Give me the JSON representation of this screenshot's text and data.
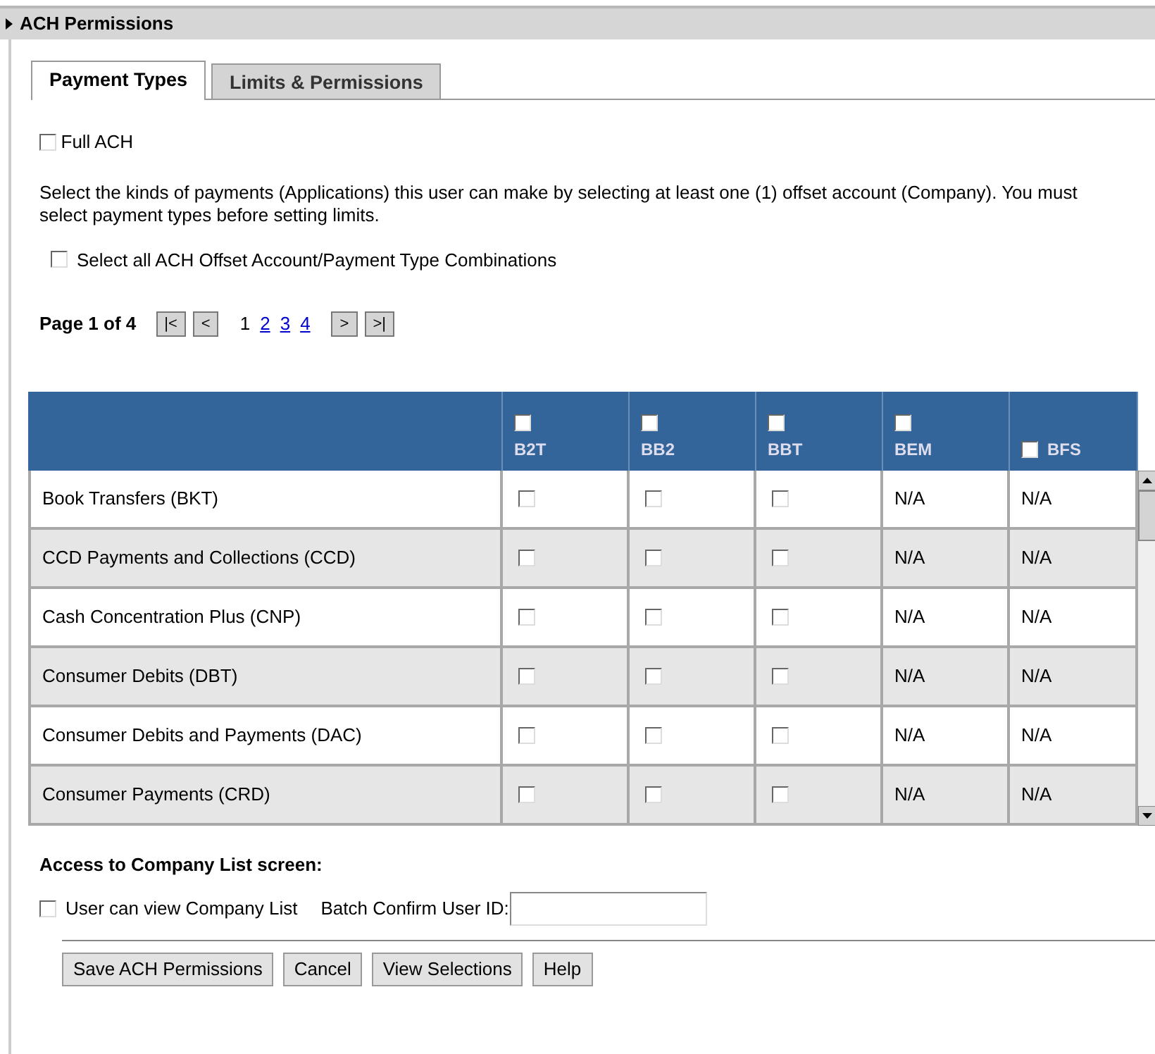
{
  "section": {
    "title": "ACH Permissions"
  },
  "tabs": [
    {
      "label": "Payment Types",
      "selected": true
    },
    {
      "label": "Limits & Permissions",
      "selected": false
    }
  ],
  "full_ach": {
    "label": "Full ACH",
    "checked": false
  },
  "description": "Select the kinds of payments (Applications) this user can make by selecting at least one (1) offset account (Company). You must select payment types before setting limits.",
  "select_all": {
    "label": "Select all ACH Offset Account/Payment Type Combinations",
    "checked": false
  },
  "pagination": {
    "label": "Page 1 of 4",
    "first": "|<",
    "prev": "<",
    "pages": [
      {
        "label": "1",
        "selected": true
      },
      {
        "label": "2",
        "selected": false
      },
      {
        "label": "3",
        "selected": false
      },
      {
        "label": "4",
        "selected": false
      }
    ],
    "next": ">",
    "last": ">|"
  },
  "table": {
    "columns": [
      {
        "label": "B2T",
        "checked": false
      },
      {
        "label": "BB2",
        "checked": false
      },
      {
        "label": "BBT",
        "checked": false
      },
      {
        "label": "BEM",
        "checked": false
      },
      {
        "label": "BFS",
        "checked": false
      }
    ],
    "rows": [
      {
        "name": "Book Transfers (BKT)",
        "cells": [
          {
            "kind": "checkbox",
            "checked": false
          },
          {
            "kind": "checkbox",
            "checked": false
          },
          {
            "kind": "checkbox",
            "checked": false
          },
          {
            "kind": "text",
            "text": "N/A"
          },
          {
            "kind": "text",
            "text": "N/A"
          }
        ]
      },
      {
        "name": "CCD Payments and Collections (CCD)",
        "cells": [
          {
            "kind": "checkbox",
            "checked": false
          },
          {
            "kind": "checkbox",
            "checked": false
          },
          {
            "kind": "checkbox",
            "checked": false
          },
          {
            "kind": "text",
            "text": "N/A"
          },
          {
            "kind": "text",
            "text": "N/A"
          }
        ]
      },
      {
        "name": "Cash Concentration Plus (CNP)",
        "cells": [
          {
            "kind": "checkbox",
            "checked": false
          },
          {
            "kind": "checkbox",
            "checked": false
          },
          {
            "kind": "checkbox",
            "checked": false
          },
          {
            "kind": "text",
            "text": "N/A"
          },
          {
            "kind": "text",
            "text": "N/A"
          }
        ]
      },
      {
        "name": "Consumer Debits (DBT)",
        "cells": [
          {
            "kind": "checkbox",
            "checked": false
          },
          {
            "kind": "checkbox",
            "checked": false
          },
          {
            "kind": "checkbox",
            "checked": false
          },
          {
            "kind": "text",
            "text": "N/A"
          },
          {
            "kind": "text",
            "text": "N/A"
          }
        ]
      },
      {
        "name": "Consumer Debits and Payments (DAC)",
        "cells": [
          {
            "kind": "checkbox",
            "checked": false
          },
          {
            "kind": "checkbox",
            "checked": false
          },
          {
            "kind": "checkbox",
            "checked": false
          },
          {
            "kind": "text",
            "text": "N/A"
          },
          {
            "kind": "text",
            "text": "N/A"
          }
        ]
      },
      {
        "name": "Consumer Payments (CRD)",
        "cells": [
          {
            "kind": "checkbox",
            "checked": false
          },
          {
            "kind": "checkbox",
            "checked": false
          },
          {
            "kind": "checkbox",
            "checked": false
          },
          {
            "kind": "text",
            "text": "N/A"
          },
          {
            "kind": "text",
            "text": "N/A"
          }
        ]
      }
    ]
  },
  "company_access": {
    "heading": "Access to Company List screen:",
    "view_list": {
      "label": "User can view Company List",
      "checked": false
    },
    "batch_label": "Batch Confirm User ID:"
  },
  "buttons": [
    "Save ACH Permissions",
    "Cancel",
    "View Selections",
    "Help"
  ]
}
